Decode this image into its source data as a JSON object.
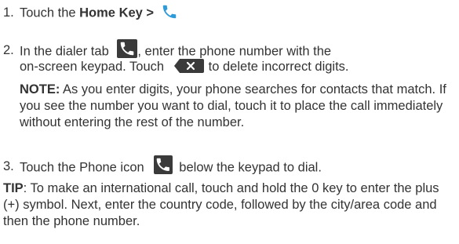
{
  "steps": [
    {
      "number": "1.",
      "text_a": "Touch the ",
      "bold": "Home Key >",
      "text_b": ""
    },
    {
      "number": "2.",
      "line1_a": "In the dialer tab",
      "line1_b": ", enter the phone number with the",
      "line2_a": "on-screen keypad. Touch",
      "line2_b": "to delete incorrect digits."
    },
    {
      "number": "3.",
      "text_a": "Touch the Phone icon",
      "text_b": "below the keypad to dial."
    }
  ],
  "note": {
    "label": "NOTE:",
    "text": "As you enter digits, your phone searches for contacts that match. If you see the number you want to dial, touch it to place the call immediately without entering the rest of the number."
  },
  "tip": {
    "label": "TIP",
    "text": ": To make an international call, touch and hold the 0 key to enter the plus (+) symbol. Next, enter the country code, followed by the city/area code and then the phone number."
  },
  "icons": {
    "phone_blue": "phone-icon",
    "phone_dark": "dialer-tab-icon",
    "delete": "delete-icon"
  },
  "colors": {
    "text": "#333333",
    "phone_blue": "#2f9ad8",
    "icon_dark": "#3a3a3a"
  }
}
